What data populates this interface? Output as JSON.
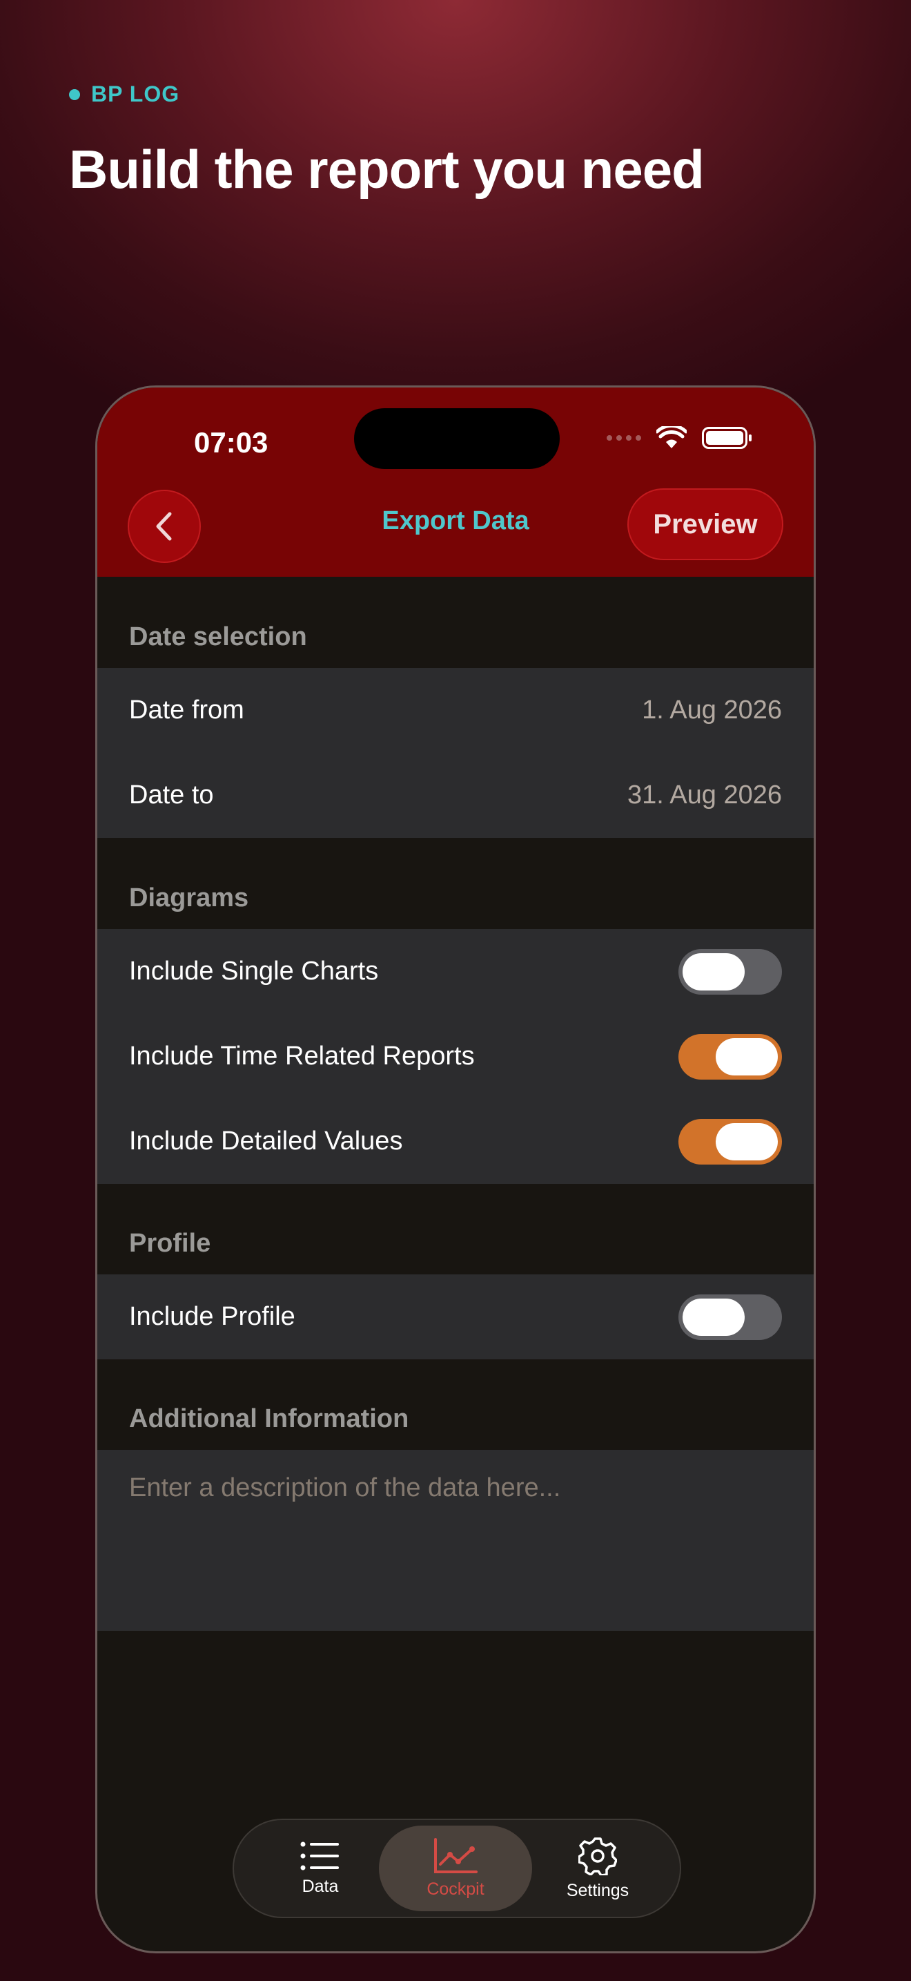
{
  "brand": {
    "label": "BP LOG",
    "accent": "#3fc7c9"
  },
  "headline": "Build the report you need",
  "status_bar": {
    "time": "07:03"
  },
  "nav": {
    "title": "Export Data",
    "preview_label": "Preview"
  },
  "sections": {
    "date_selection": {
      "header": "Date selection",
      "date_from_label": "Date from",
      "date_from_value": "1. Aug 2026",
      "date_to_label": "Date to",
      "date_to_value": "31. Aug 2026"
    },
    "diagrams": {
      "header": "Diagrams",
      "single_charts": {
        "label": "Include Single Charts",
        "on": false
      },
      "time_reports": {
        "label": "Include Time Related Reports",
        "on": true
      },
      "detailed_values": {
        "label": "Include Detailed Values",
        "on": true
      }
    },
    "profile": {
      "header": "Profile",
      "include_profile": {
        "label": "Include Profile",
        "on": false
      }
    },
    "additional": {
      "header": "Additional Information",
      "placeholder": "Enter a description of the data here..."
    }
  },
  "tabbar": {
    "data": "Data",
    "cockpit": "Cockpit",
    "settings": "Settings",
    "active": "cockpit"
  },
  "colors": {
    "topbar": "#780405",
    "toggle_on": "#d2732a",
    "toggle_off": "#5f5f63",
    "nav_title": "#4fc7cc",
    "active_tab": "#d54b45"
  }
}
